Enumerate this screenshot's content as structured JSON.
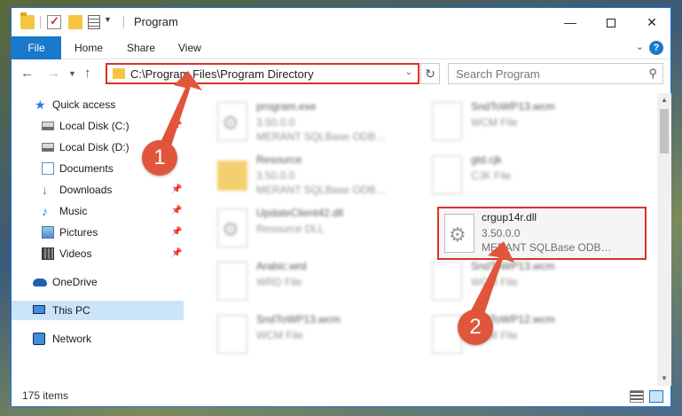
{
  "window": {
    "title": "Program",
    "controls": {
      "minimize": "—",
      "maximize": "",
      "close": "✕"
    }
  },
  "ribbon": {
    "tabs": [
      "File",
      "Home",
      "Share",
      "View"
    ],
    "help": "?"
  },
  "address": {
    "path": "C:\\Program Files\\Program Directory",
    "search_placeholder": "Search Program"
  },
  "sidebar": {
    "items": [
      {
        "label": "Quick access",
        "icon": "star-icon"
      },
      {
        "label": "Local Disk (C:)",
        "icon": "drive-icon"
      },
      {
        "label": "Local Disk (D:)",
        "icon": "drive-icon"
      },
      {
        "label": "Documents",
        "icon": "documents-icon"
      },
      {
        "label": "Downloads",
        "icon": "download-icon"
      },
      {
        "label": "Music",
        "icon": "music-icon"
      },
      {
        "label": "Pictures",
        "icon": "pictures-icon"
      },
      {
        "label": "Videos",
        "icon": "videos-icon"
      },
      {
        "label": "OneDrive",
        "icon": "cloud-icon"
      },
      {
        "label": "This PC",
        "icon": "computer-icon"
      },
      {
        "label": "Network",
        "icon": "network-icon"
      }
    ]
  },
  "files": [
    {
      "name": "program.exe",
      "line2": "3.50.0.0",
      "line3": "MERANT SQLBase ODBC..."
    },
    {
      "name": "SndToWP13.wcm",
      "line2": "WCM File",
      "line3": ""
    },
    {
      "name": "Resource",
      "line2": "3.50.0.0",
      "line3": "MERANT SQLBase ODBC..."
    },
    {
      "name": "gtd.cjk",
      "line2": "CJK File",
      "line3": ""
    },
    {
      "name": "UpdateClient42.dll",
      "line2": "Resource DLL",
      "line3": ""
    },
    {
      "name": "crgup14r.dll",
      "line2": "3.50.0.0",
      "line3": "MERANT SQLBase ODBC..."
    },
    {
      "name": "Arabic.wrd",
      "line2": "WRD File",
      "line3": ""
    },
    {
      "name": "SndToWP13.wcm",
      "line2": "WCM File",
      "line3": ""
    },
    {
      "name": "SndToWP13.wcm",
      "line2": "WCM File",
      "line3": ""
    },
    {
      "name": "SndToWP12.wcm",
      "line2": "WCM File",
      "line3": ""
    }
  ],
  "status": {
    "count": "175 items"
  },
  "annotations": {
    "step1": "1",
    "step2": "2"
  },
  "colors": {
    "accent": "#1979ca",
    "annotation": "#e1553a",
    "highlight_border": "#d9302c"
  }
}
